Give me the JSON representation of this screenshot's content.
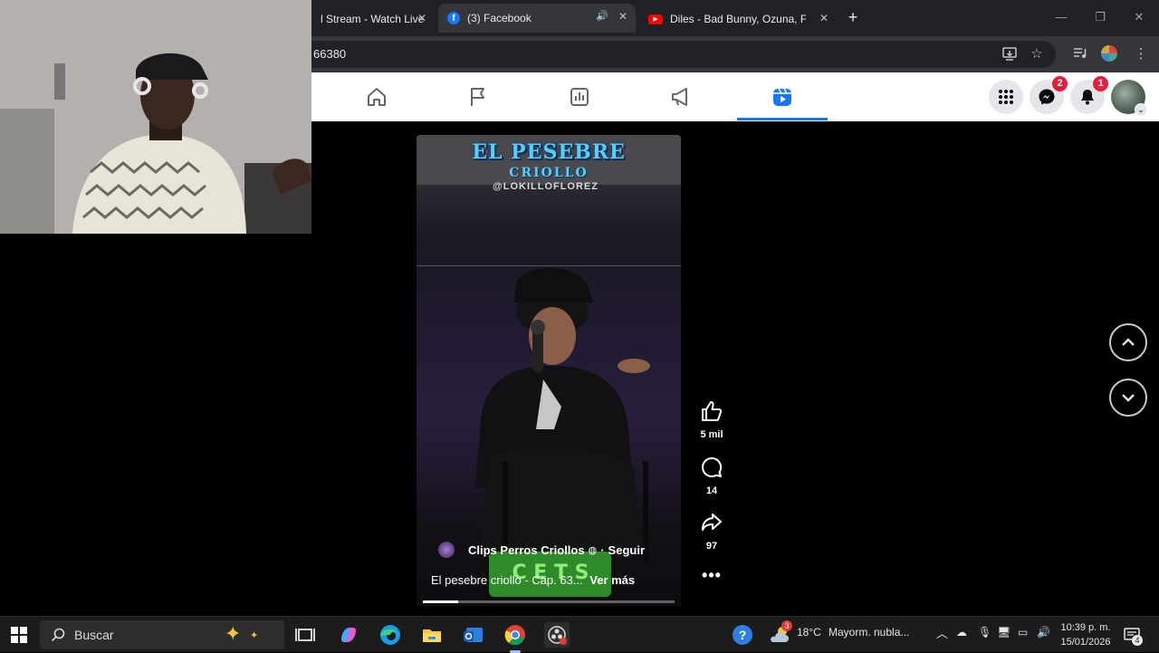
{
  "browser": {
    "tabs": [
      {
        "title": "l Stream - Watch Live",
        "active": false
      },
      {
        "title": "(3) Facebook",
        "active": true
      },
      {
        "title": "Diles - Bad Bunny, Ozuna, Farru",
        "active": false
      }
    ],
    "address": "66380"
  },
  "facebook": {
    "messenger_badge": "2",
    "notifications_badge": "1"
  },
  "video": {
    "overlay_title": "EL PESEBRE",
    "overlay_subtitle": "CRIOLLO",
    "overlay_handle": "@LOKILLOFLOREZ",
    "channel_name": "Clips Perros Criollos",
    "follow_label": "Seguir",
    "caption": "El pesebre criollo - Cap. 63...",
    "see_more": "Ver más",
    "progress": 0.14
  },
  "actions": {
    "likes": "5 mil",
    "comments": "14",
    "shares": "97"
  },
  "taskbar": {
    "search_placeholder": "Buscar",
    "weather_temp": "18°C",
    "weather_desc": "Mayorm. nubla...",
    "weather_badge": "3",
    "time": "10:39 p. m.",
    "date": "15/01/2026",
    "notif_count": "4"
  },
  "colors": {
    "facebook_blue": "#1877f2",
    "badge_red": "#e41e3f",
    "youtube_red": "#ff0000"
  }
}
